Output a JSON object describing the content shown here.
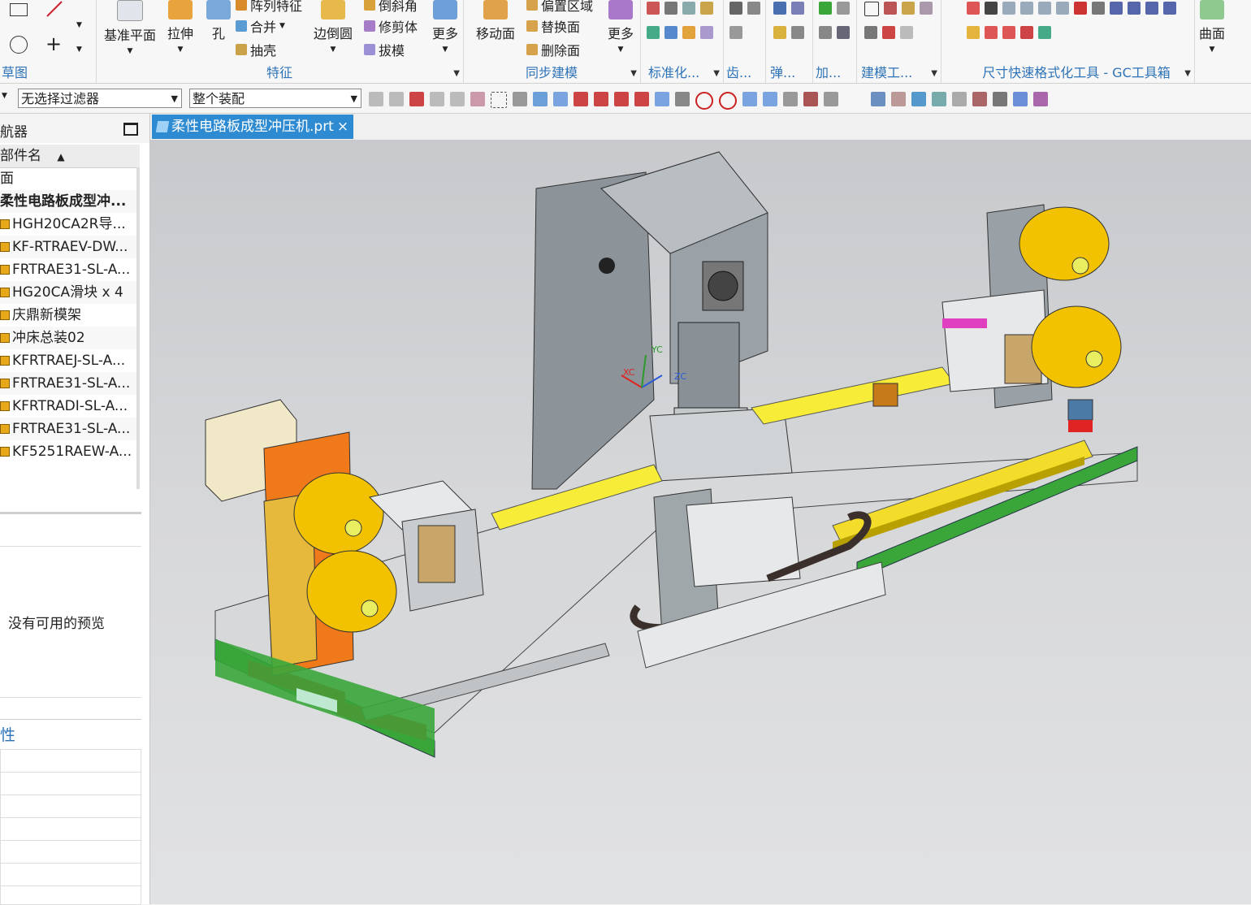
{
  "ribbon": {
    "sketch_group": "草图",
    "feature_group": "特征",
    "datum_plane": "基准平面",
    "extrude": "拉伸",
    "hole": "孔",
    "pattern_feature": "阵列特征",
    "unite": "合并",
    "shell": "抽壳",
    "edge_blend": "边倒圆",
    "chamfer": "倒斜角",
    "trim_body": "修剪体",
    "draft": "拔模",
    "more1": "更多",
    "sync_group": "同步建模",
    "move_face": "移动面",
    "offset_region": "偏置区域",
    "replace_face": "替换面",
    "delete_face": "删除面",
    "more2": "更多",
    "standard_group": "标准化...",
    "gear_group": "齿...",
    "spring_group": "弹...",
    "add_group": "加...",
    "modeling_tools_group": "建模工...",
    "dim_tools_group": "尺寸快速格式化工具 - GC工具箱",
    "surface": "曲面"
  },
  "toolbar": {
    "filter_value": "无选择过滤器",
    "scope_value": "整个装配"
  },
  "navigator": {
    "title": "航器",
    "column_header": "部件名",
    "rows": [
      {
        "label": "面",
        "bold": false,
        "icon": false
      },
      {
        "label": "柔性电路板成型冲...",
        "bold": true,
        "icon": false
      },
      {
        "label": "HGH20CA2R导...",
        "bold": false,
        "icon": true
      },
      {
        "label": "KF-RTRAEV-DW...",
        "bold": false,
        "icon": true
      },
      {
        "label": "FRTRAE31-SL-A...",
        "bold": false,
        "icon": true
      },
      {
        "label": "HG20CA滑块 x 4",
        "bold": false,
        "icon": true
      },
      {
        "label": "庆鼎新模架",
        "bold": false,
        "icon": true
      },
      {
        "label": "冲床总装02",
        "bold": false,
        "icon": true
      },
      {
        "label": "KFRTRAEJ-SL-A...",
        "bold": false,
        "icon": true
      },
      {
        "label": "FRTRAE31-SL-A...",
        "bold": false,
        "icon": true
      },
      {
        "label": "KFRTRADI-SL-A...",
        "bold": false,
        "icon": true
      },
      {
        "label": "FRTRAE31-SL-A...",
        "bold": false,
        "icon": true
      },
      {
        "label": "KF5251RAEW-A...",
        "bold": false,
        "icon": true
      }
    ],
    "preview_text": "没有可用的预览",
    "properties_title": "性"
  },
  "tab": {
    "title": "柔性电路板成型冲压机.prt",
    "close": "×"
  },
  "axes": {
    "x": "XC",
    "y": "YC",
    "z": "ZC"
  },
  "colors": {
    "accent_blue": "#2e8bd1",
    "machine_gray": "#8c9499",
    "roll_yellow": "#f2c100",
    "rail_green": "#3aa63a",
    "alert_red": "#e02424",
    "orange_cabinet": "#f07a1a"
  }
}
